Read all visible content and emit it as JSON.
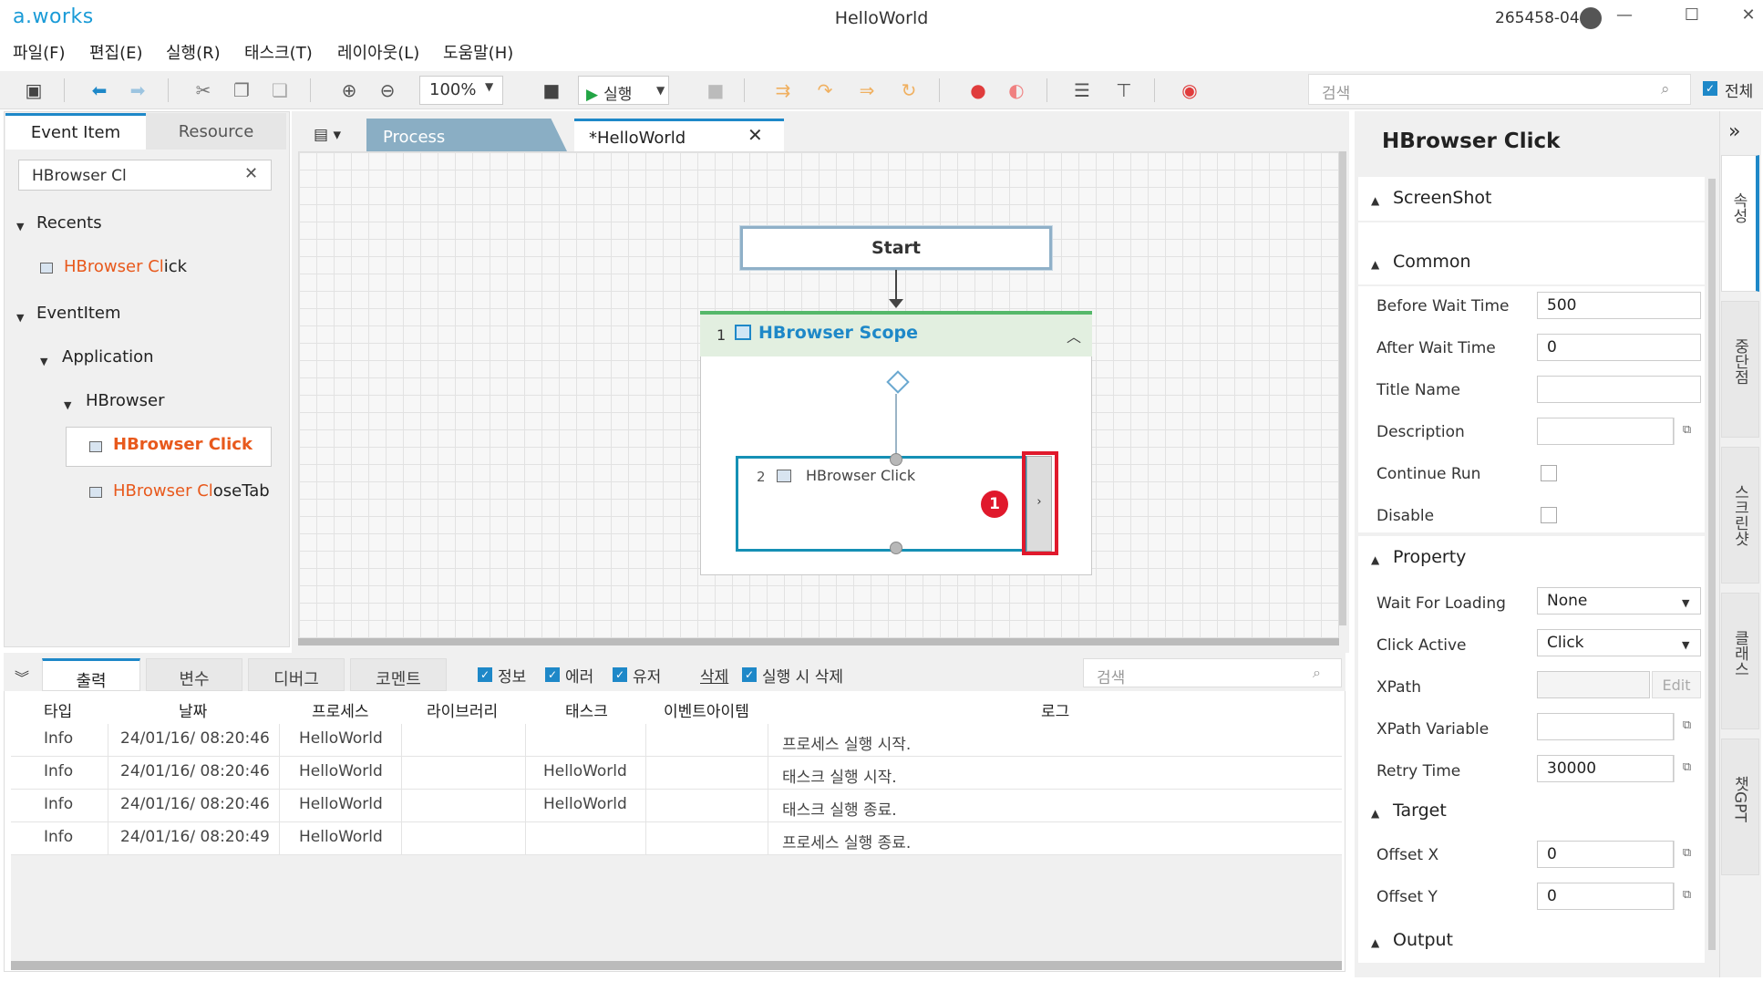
{
  "app": {
    "logo": "a.works",
    "title": "HelloWorld",
    "user_id": "265458-04",
    "win_minimize": "—",
    "win_maximize": "☐",
    "win_close": "✕"
  },
  "menu": [
    "파일(F)",
    "편집(E)",
    "실행(R)",
    "태스크(T)",
    "레이아웃(L)",
    "도움말(H)"
  ],
  "toolbar": {
    "zoom": "100%",
    "run_label": "실행",
    "search_placeholder": "검색",
    "all_label": "전체",
    "icons": [
      "save-icon",
      "back-icon",
      "forward-icon",
      "cut-icon",
      "copy-icon",
      "paste-icon",
      "zoom-in-icon",
      "zoom-out-icon",
      "record-video-icon",
      "stop-icon",
      "step-over-icon",
      "step-into-icon",
      "step-out-icon",
      "step-return-icon",
      "breakpoint-add-icon",
      "breakpoint-remove-icon",
      "align-center-icon",
      "align-vertical-icon",
      "record-icon"
    ]
  },
  "left_panel": {
    "tabs": [
      "Event Item",
      "Resource"
    ],
    "search_value": "HBrowser Cl",
    "tree": {
      "recents_label": "Recents",
      "recent_item_hl": "HBrowser Cl",
      "recent_item_rest": "ick",
      "eventitem_label": "EventItem",
      "application_label": "Application",
      "hbrowser_label": "HBrowser",
      "click_item_hl": "HBrowser Click",
      "closetab_hl": "HBrowser Cl",
      "closetab_rest": "oseTab"
    }
  },
  "doc_tabs": {
    "process": "Process",
    "hello": "*HelloWorld"
  },
  "canvas": {
    "start_label": "Start",
    "scope_num": "1",
    "scope_title": "HBrowser Scope",
    "click_num": "2",
    "click_title": "HBrowser Click",
    "expand_glyph": "›",
    "badge_num": "1"
  },
  "bottom": {
    "tabs": [
      "출력",
      "변수",
      "디버그",
      "코멘트"
    ],
    "filters": [
      "정보",
      "에러",
      "유저"
    ],
    "delete_label": "삭제",
    "delete_on_run": "실행 시 삭제",
    "search_placeholder": "검색",
    "columns": [
      "타입",
      "날짜",
      "프로세스",
      "라이브러리",
      "태스크",
      "이벤트아이템",
      "로그"
    ],
    "rows": [
      {
        "type": "Info",
        "date": "24/01/16/ 08:20:46",
        "process": "HelloWorld",
        "library": "",
        "task": "",
        "event": "",
        "log": "프로세스 실행 시작."
      },
      {
        "type": "Info",
        "date": "24/01/16/ 08:20:46",
        "process": "HelloWorld",
        "library": "",
        "task": "HelloWorld",
        "event": "",
        "log": "태스크 실행 시작."
      },
      {
        "type": "Info",
        "date": "24/01/16/ 08:20:46",
        "process": "HelloWorld",
        "library": "",
        "task": "HelloWorld",
        "event": "",
        "log": "태스크 실행 종료."
      },
      {
        "type": "Info",
        "date": "24/01/16/ 08:20:49",
        "process": "HelloWorld",
        "library": "",
        "task": "",
        "event": "",
        "log": "프로세스 실행 종료."
      }
    ]
  },
  "properties": {
    "title": "HBrowser Click",
    "sections": {
      "screenshot": "ScreenShot",
      "common": "Common",
      "property": "Property",
      "target": "Target",
      "output": "Output"
    },
    "fields": {
      "before_wait_label": "Before Wait Time",
      "before_wait_value": "500",
      "after_wait_label": "After Wait Time",
      "after_wait_value": "0",
      "title_name_label": "Title Name",
      "title_name_value": "",
      "description_label": "Description",
      "description_value": "",
      "continue_run_label": "Continue Run",
      "disable_label": "Disable",
      "wait_loading_label": "Wait For Loading",
      "wait_loading_value": "None",
      "click_active_label": "Click Active",
      "click_active_value": "Click",
      "xpath_label": "XPath",
      "xpath_value": "",
      "xpath_edit": "Edit",
      "xpath_var_label": "XPath Variable",
      "xpath_var_value": "",
      "retry_label": "Retry Time",
      "retry_value": "30000",
      "offset_x_label": "Offset X",
      "offset_x_value": "0",
      "offset_y_label": "Offset Y",
      "offset_y_value": "0"
    }
  },
  "side_tabs": [
    "속성",
    "중단점",
    "스크린샷",
    "클래스",
    "챗GPT"
  ],
  "colors": {
    "accent": "#1e88c8",
    "highlight_orange": "#e8591c",
    "scope_green": "#55b86a",
    "marker_red": "#e0192c"
  }
}
